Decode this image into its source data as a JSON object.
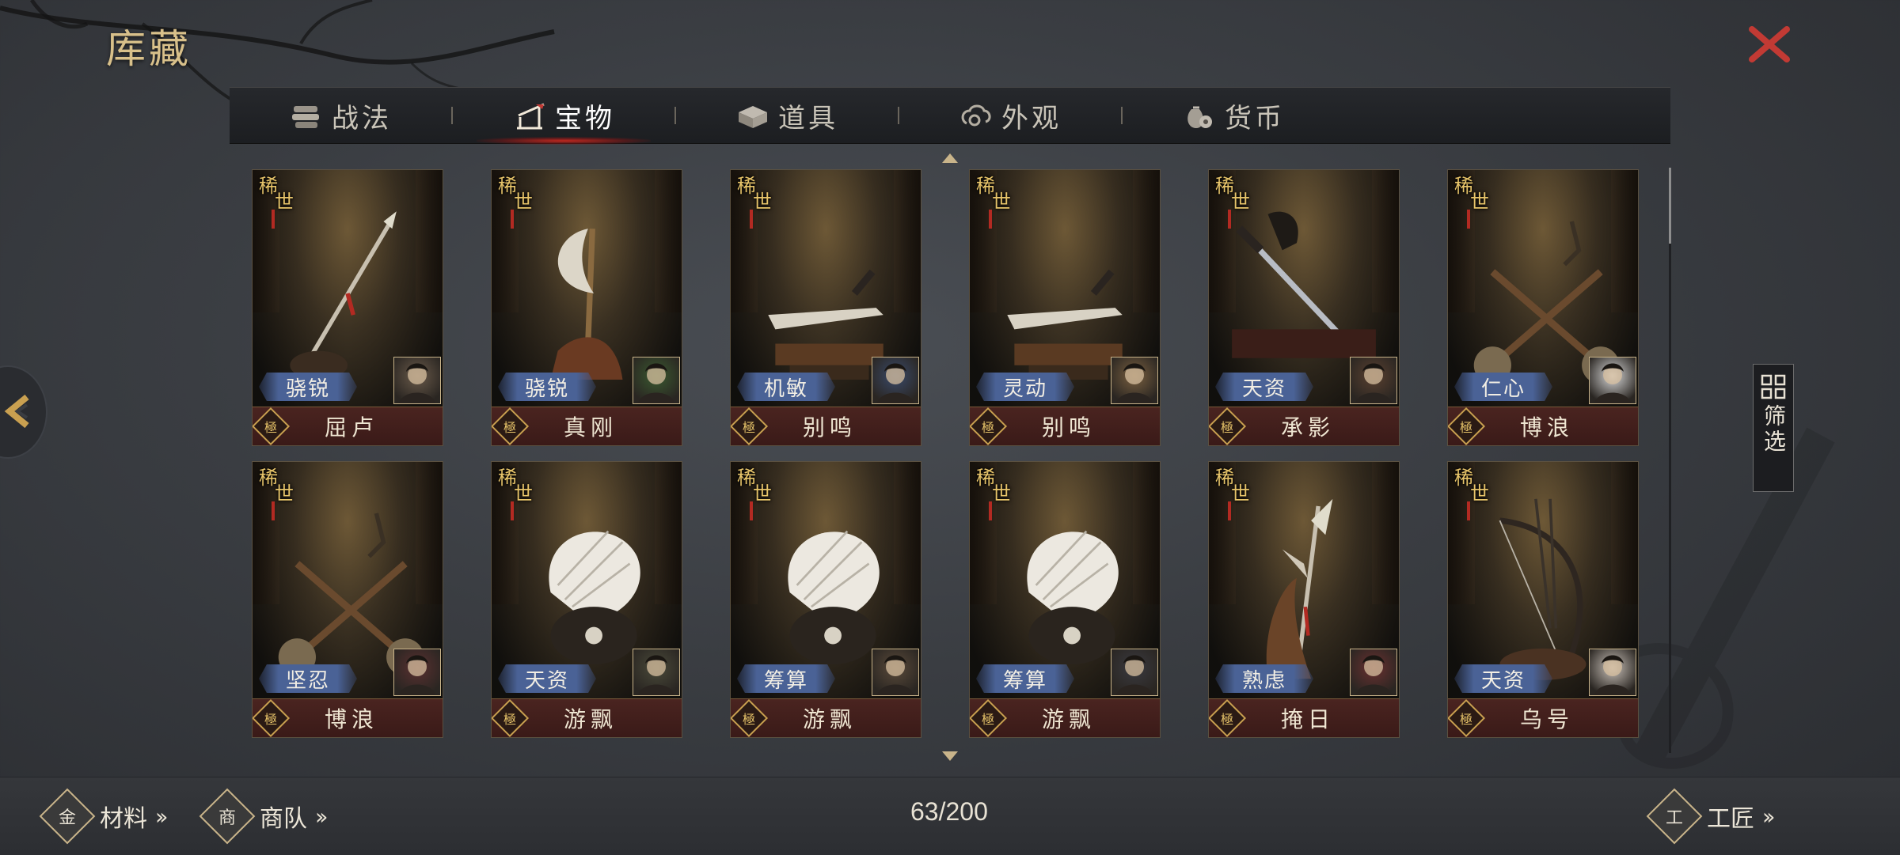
{
  "title": "库藏",
  "tabs": [
    {
      "label": "战法",
      "icon": "scroll-bundle-icon",
      "active": false
    },
    {
      "label": "宝物",
      "icon": "weapon-rack-icon",
      "active": true
    },
    {
      "label": "道具",
      "icon": "chest-icon",
      "active": false
    },
    {
      "label": "外观",
      "icon": "cloud-swirl-icon",
      "active": false
    },
    {
      "label": "货币",
      "icon": "coin-pouch-icon",
      "active": false
    }
  ],
  "cards": [
    {
      "rarity": "稀世",
      "trait": "骁锐",
      "grade": "極",
      "name": "屈卢",
      "weapon": "spear"
    },
    {
      "rarity": "稀世",
      "trait": "骁锐",
      "grade": "極",
      "name": "真刚",
      "weapon": "axe"
    },
    {
      "rarity": "稀世",
      "trait": "机敏",
      "grade": "極",
      "name": "别鸣",
      "weapon": "dagger"
    },
    {
      "rarity": "稀世",
      "trait": "灵动",
      "grade": "極",
      "name": "别鸣",
      "weapon": "dagger"
    },
    {
      "rarity": "稀世",
      "trait": "天资",
      "grade": "極",
      "name": "承影",
      "weapon": "sword"
    },
    {
      "rarity": "稀世",
      "trait": "仁心",
      "grade": "極",
      "name": "博浪",
      "weapon": "hammers"
    },
    {
      "rarity": "稀世",
      "trait": "坚忍",
      "grade": "極",
      "name": "博浪",
      "weapon": "hammers"
    },
    {
      "rarity": "稀世",
      "trait": "天资",
      "grade": "極",
      "name": "游飘",
      "weapon": "fan"
    },
    {
      "rarity": "稀世",
      "trait": "筹算",
      "grade": "極",
      "name": "游飘",
      "weapon": "fan"
    },
    {
      "rarity": "稀世",
      "trait": "筹算",
      "grade": "極",
      "name": "游飘",
      "weapon": "fan"
    },
    {
      "rarity": "稀世",
      "trait": "熟虑",
      "grade": "極",
      "name": "掩日",
      "weapon": "halberd"
    },
    {
      "rarity": "稀世",
      "trait": "天资",
      "grade": "極",
      "name": "乌号",
      "weapon": "bow"
    }
  ],
  "filter_label": "筛选",
  "bottom": {
    "materials_label": "材料",
    "materials_glyph": "金",
    "caravan_label": "商队",
    "caravan_glyph": "商",
    "craftsman_label": "工匠",
    "craftsman_glyph": "工",
    "counter": "63/200"
  },
  "colors": {
    "accent_gold": "#d8c08a",
    "close_red": "#c23a34",
    "trait_blue": "#4a6296",
    "namebar_red": "#4a2420",
    "tab_glow": "#c8281e"
  }
}
